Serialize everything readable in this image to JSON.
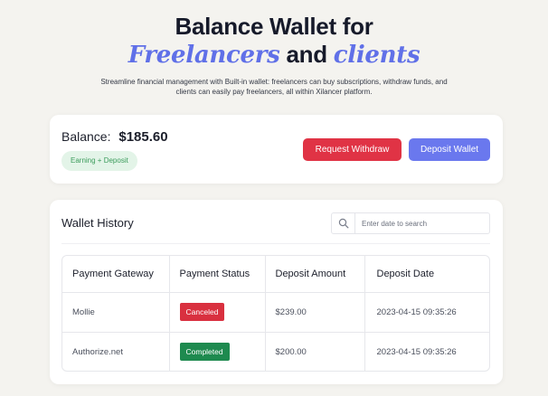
{
  "hero": {
    "title_line1": "Balance Wallet for",
    "title_accent1": "Freelancers",
    "title_and": "and",
    "title_accent2": "clients",
    "subtitle": "Streamline financial management with Built-in wallet: freelancers can buy subscriptions, withdraw funds, and clients can easily pay freelancers, all within Xilancer platform."
  },
  "balance": {
    "label": "Balance:",
    "amount": "$185.60",
    "badge": "Earning + Deposit",
    "withdraw_label": "Request Withdraw",
    "deposit_label": "Deposit Wallet"
  },
  "history": {
    "title": "Wallet History",
    "search_placeholder": "Enter date to search",
    "columns": [
      "Payment Gateway",
      "Payment Status",
      "Deposit Amount",
      "Deposit Date"
    ],
    "rows": [
      {
        "gateway": "Mollie",
        "status": "Canceled",
        "amount": "$239.00",
        "date": "2023-04-15 09:35:26"
      },
      {
        "gateway": "Authorize.net",
        "status": "Completed",
        "amount": "$200.00",
        "date": "2023-04-15 09:35:26"
      }
    ]
  },
  "icons": {
    "search": "search-icon"
  },
  "colors": {
    "accent": "#6070e8",
    "withdraw": "#e03345",
    "deposit": "#6a78ee",
    "canceled": "#d9303f",
    "completed": "#1e8a4f",
    "pill_bg": "#e3f4e8",
    "pill_text": "#3c9c5c"
  }
}
